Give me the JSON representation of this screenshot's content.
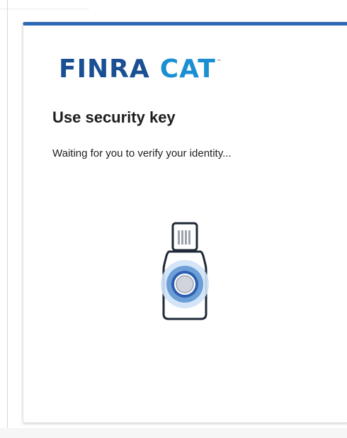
{
  "logo": {
    "text_primary": "FINRA",
    "text_secondary": "CAT",
    "trademark": "™",
    "colors": {
      "primary": "#1a4f93",
      "secondary": "#1c8fd2"
    }
  },
  "dialog": {
    "title": "Use security key",
    "status_text": "Waiting for you to verify your identity...",
    "icon": "security-key-icon",
    "accent_color": "#2c68b4"
  }
}
